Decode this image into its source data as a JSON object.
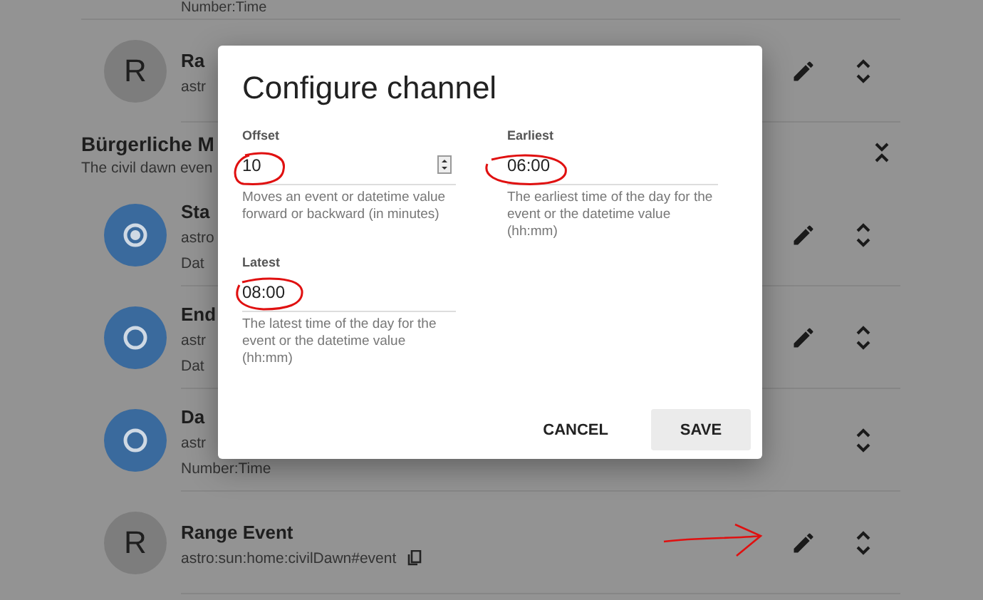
{
  "list": {
    "top_partial": "Number:Time",
    "first_row": {
      "avatar": {
        "kind": "letter",
        "letter": "R"
      },
      "title": "Ra",
      "lines": [
        "astr"
      ],
      "edit": true,
      "copy": false
    },
    "section": {
      "title": "Bürgerliche M",
      "subtitle": "The civil dawn even",
      "expanded": true
    },
    "rows": [
      {
        "avatar": {
          "kind": "icon",
          "dot": true
        },
        "title": "Sta",
        "lines": [
          "astro",
          "Dat"
        ],
        "edit": true,
        "copy": false
      },
      {
        "avatar": {
          "kind": "icon",
          "dot": false
        },
        "title": "End",
        "lines": [
          "astr",
          "Dat"
        ],
        "edit": true,
        "copy": false
      },
      {
        "avatar": {
          "kind": "icon",
          "dot": false
        },
        "title": "Da",
        "lines": [
          "astr",
          "Number:Time"
        ],
        "edit": false,
        "copy": false
      },
      {
        "avatar": {
          "kind": "letter",
          "letter": "R"
        },
        "title": "Range Event",
        "lines": [
          "astro:sun:home:civilDawn#event"
        ],
        "edit": true,
        "copy": true
      }
    ]
  },
  "dialog": {
    "title": "Configure channel",
    "fields": [
      {
        "kind": "number",
        "label": "Offset",
        "value": "10",
        "helper": "Moves an event or datetime value forward or backward (in minutes)"
      },
      {
        "kind": "text",
        "label": "Earliest",
        "value": "06:00",
        "helper": "The earliest time of the day for the event or the datetime value (hh:mm)"
      },
      {
        "kind": "text",
        "label": "Latest",
        "value": "08:00",
        "helper": "The latest time of the day for the event or the datetime value (hh:mm)"
      }
    ],
    "buttons": [
      {
        "label": "CANCEL",
        "kind": "flat"
      },
      {
        "label": "SAVE",
        "kind": "raised"
      }
    ]
  }
}
